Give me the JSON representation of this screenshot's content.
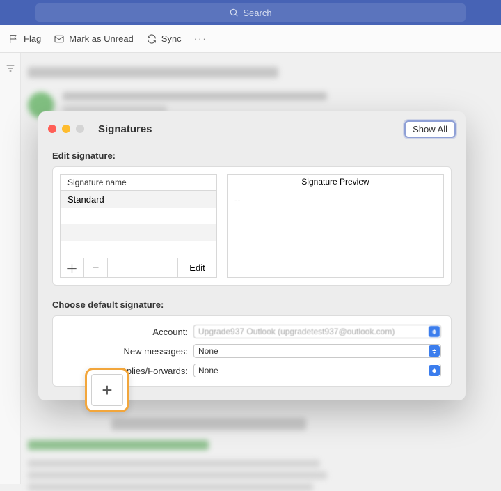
{
  "topbar": {
    "search_placeholder": "Search"
  },
  "toolbar": {
    "flag": "Flag",
    "unread": "Mark as Unread",
    "sync": "Sync",
    "more": "···"
  },
  "modal": {
    "title": "Signatures",
    "show_all": "Show All",
    "edit_label": "Edit signature:",
    "sig_name_header": "Signature name",
    "signatures": [
      "Standard"
    ],
    "edit_btn": "Edit",
    "plus_glyph": "＋",
    "minus_glyph": "−",
    "highlight_glyph": "+",
    "preview_header": "Signature Preview",
    "preview_body": "--",
    "choose_label": "Choose default signature:",
    "defaults": {
      "account_label": "Account:",
      "account_value": "Upgrade937 Outlook (upgradetest937@outlook.com)",
      "newmsg_label": "New messages:",
      "newmsg_value": "None",
      "replies_label": "Replies/Forwards:",
      "replies_value": "None"
    }
  }
}
